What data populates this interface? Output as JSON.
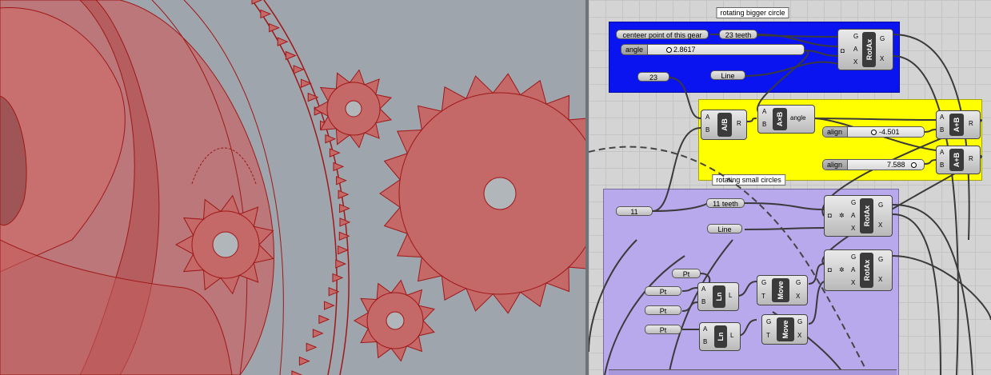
{
  "viewport": {
    "name": "rhino-viewport",
    "colors": {
      "background": "#9ea5ac",
      "gear_fill": "#c46868",
      "gear_stroke": "#a01818"
    }
  },
  "canvas": {
    "groups": {
      "blue": {
        "label": "rotating bigger circle",
        "color": "#0a14f0"
      },
      "yellow": {
        "label": "",
        "color": "#ffff00"
      },
      "purple": {
        "label": "rotating small circles",
        "color": "#b8a8ec"
      }
    },
    "panels": {
      "center_point": "centeer point of this gear",
      "teeth23": "23 teeth",
      "num23": "23",
      "line1": "Line",
      "num11": "11",
      "teeth11": "11 teeth",
      "line2": "Line",
      "pt1": "Pt",
      "pt2": "Pt",
      "pt3": "Pt",
      "pt4": "Pt"
    },
    "sliders": {
      "angle": {
        "name": "angle",
        "value": "2.8617"
      },
      "align1": {
        "name": "align",
        "value": "-4.501"
      },
      "align2": {
        "name": "align",
        "value": "7.588"
      }
    },
    "components": {
      "rotax1": {
        "title": "RotAx",
        "inputs": [
          "G",
          "A",
          "X"
        ],
        "outputs": [
          "G",
          "X"
        ]
      },
      "div": {
        "title": "A/B",
        "inputs": [
          "A",
          "B"
        ],
        "outputs": [
          "R"
        ]
      },
      "mul": {
        "title": "A×B",
        "inputs": [
          "A",
          "B"
        ],
        "outputs": [
          "angle"
        ]
      },
      "add1": {
        "title": "A+B",
        "inputs": [
          "A",
          "B"
        ],
        "outputs": [
          "R"
        ]
      },
      "add2": {
        "title": "A+B",
        "inputs": [
          "A",
          "B"
        ],
        "outputs": [
          "R"
        ]
      },
      "rotax2": {
        "title": "RotAx",
        "inputs": [
          "G",
          "A",
          "X"
        ],
        "outputs": [
          "G",
          "X"
        ]
      },
      "rotax3": {
        "title": "RotAx",
        "inputs": [
          "G",
          "A",
          "X"
        ],
        "outputs": [
          "G",
          "X"
        ]
      },
      "ln1": {
        "title": "Ln",
        "inputs": [
          "A",
          "B"
        ],
        "outputs": [
          "L"
        ]
      },
      "ln2": {
        "title": "Ln",
        "inputs": [
          "A",
          "B"
        ],
        "outputs": [
          "L"
        ]
      },
      "move1": {
        "title": "Move",
        "inputs": [
          "G",
          "T"
        ],
        "outputs": [
          "G",
          "X"
        ]
      },
      "move2": {
        "title": "Move",
        "inputs": [
          "G",
          "T"
        ],
        "outputs": [
          "G",
          "X"
        ]
      }
    }
  }
}
